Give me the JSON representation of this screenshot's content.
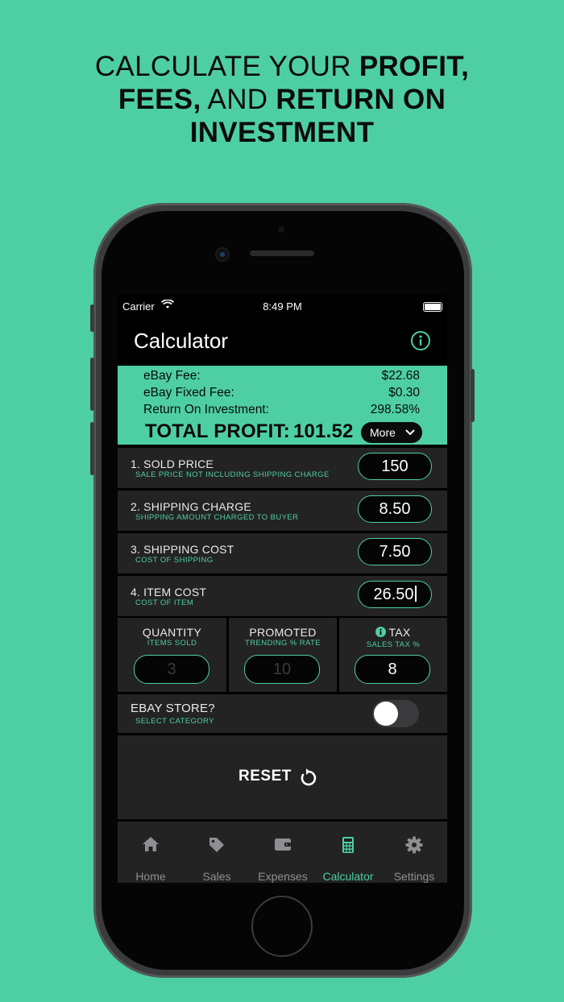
{
  "headline": {
    "line1_plain": "CALCULATE YOUR ",
    "line1_bold": "PROFIT,",
    "line2_bold1": "FEES,",
    "line2_plain": " AND ",
    "line2_bold2": "RETURN ON",
    "line3_bold": "INVESTMENT"
  },
  "status": {
    "carrier": "Carrier",
    "time": "8:49 PM"
  },
  "nav": {
    "title": "Calculator",
    "info_icon": "info-circle-icon"
  },
  "summary": {
    "rows": [
      {
        "label": "eBay Fee:",
        "value": "$22.68"
      },
      {
        "label": "eBay Fixed Fee:",
        "value": "$0.30"
      },
      {
        "label": "Return On Investment:",
        "value": "298.58%"
      }
    ],
    "total_label": "TOTAL PROFIT:",
    "total_value": "101.52",
    "more_label": "More"
  },
  "fields": [
    {
      "title": "1. SOLD PRICE",
      "subtitle": "SALE PRICE NOT INCLUDING SHIPPING CHARGE",
      "value": "150"
    },
    {
      "title": "2. SHIPPING CHARGE",
      "subtitle": "SHIPPING AMOUNT CHARGED TO BUYER",
      "value": "8.50"
    },
    {
      "title": "3. SHIPPING COST",
      "subtitle": "COST OF SHIPPING",
      "value": "7.50"
    },
    {
      "title": "4. ITEM COST",
      "subtitle": "COST OF ITEM",
      "value": "26.50"
    }
  ],
  "extras": {
    "quantity": {
      "title": "QUANTITY",
      "subtitle": "ITEMS SOLD",
      "placeholder": "3"
    },
    "promoted": {
      "title": "PROMOTED",
      "subtitle": "TRENDING % RATE",
      "placeholder": "10"
    },
    "tax": {
      "title": "TAX",
      "subtitle": "SALES TAX %",
      "value": "8"
    }
  },
  "store": {
    "title": "EBAY STORE?",
    "subtitle": "SELECT CATEGORY",
    "enabled": false
  },
  "reset": {
    "label": "RESET"
  },
  "tabs": [
    {
      "label": "Home",
      "icon": "house-icon",
      "active": false
    },
    {
      "label": "Sales",
      "icon": "tag-icon",
      "active": false
    },
    {
      "label": "Expenses",
      "icon": "wallet-icon",
      "active": false
    },
    {
      "label": "Calculator",
      "icon": "calculator-icon",
      "active": true
    },
    {
      "label": "Settings",
      "icon": "gear-icon",
      "active": false
    }
  ],
  "colors": {
    "accent": "#4ecfa3",
    "cell": "#232323",
    "background": "#4ecfa3"
  }
}
